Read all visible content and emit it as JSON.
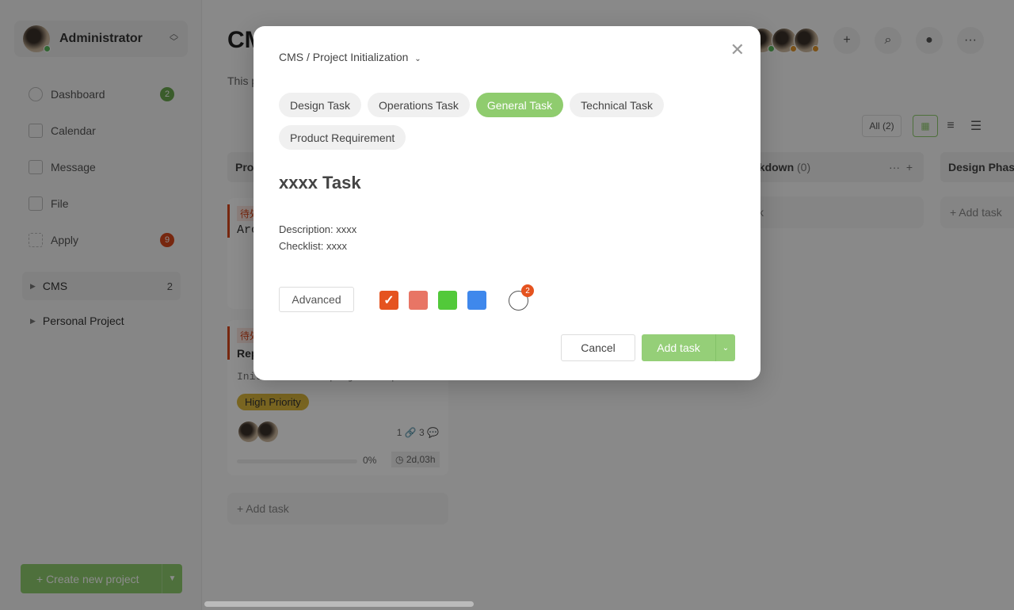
{
  "user": {
    "name": "Administrator"
  },
  "sidebar": {
    "items": [
      {
        "label": "Dashboard",
        "badge": "2"
      },
      {
        "label": "Calendar"
      },
      {
        "label": "Message"
      },
      {
        "label": "File"
      },
      {
        "label": "Apply",
        "badge": "9"
      }
    ],
    "projects": [
      {
        "label": "CMS",
        "count": "2"
      },
      {
        "label": "Personal Project"
      }
    ],
    "create_label": "+  Create new project"
  },
  "main": {
    "title": "CMS",
    "description": "This project ... streamline content creation, editing, and manag...",
    "filter_all": "All (2)",
    "columns": [
      {
        "title": "Pro"
      },
      {
        "title": "akdown",
        "count": "(0)"
      },
      {
        "title": "Design Phas"
      }
    ],
    "cards": [
      {
        "tag": "待处",
        "title": "Arc"
      },
      {
        "tag": "待处",
        "title": "Rep",
        "desc": "Initialize the project reposit",
        "priority": "High Priority",
        "links": "1",
        "comments": "3",
        "progress": "0%",
        "time": "2d,03h"
      }
    ],
    "add_task": "+ Add task",
    "add_task_partial": "sk"
  },
  "modal": {
    "breadcrumb": "CMS / Project Initialization",
    "chips": [
      "Design Task",
      "Operations Task",
      "General Task",
      "Technical Task",
      "Product Requirement"
    ],
    "active_chip": "General Task",
    "task_title": "xxxx Task",
    "description": "Description: xxxx",
    "checklist": "Checklist: xxxx",
    "advanced": "Advanced",
    "colors": [
      "#e5531f",
      "#e87565",
      "#52c93a",
      "#3f88ec"
    ],
    "clock_badge": "2",
    "cancel": "Cancel",
    "add_task": "Add task"
  }
}
